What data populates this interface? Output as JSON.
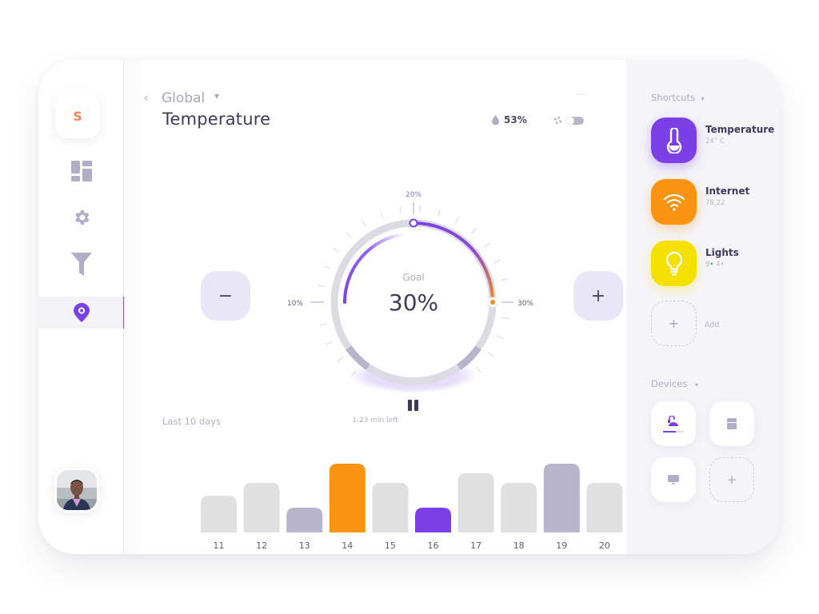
{
  "sidebar": {
    "logo_letter": "S",
    "nav": [
      {
        "name": "dashboard",
        "icon": "dashboard-icon",
        "active": false
      },
      {
        "name": "settings",
        "icon": "gear-icon",
        "active": false
      },
      {
        "name": "filter",
        "icon": "filter-icon",
        "active": false
      },
      {
        "name": "location",
        "icon": "location-pin-icon",
        "active": true
      }
    ],
    "avatar_alt": "User avatar"
  },
  "header": {
    "back_icon": "‹",
    "breadcrumb": "Global",
    "breadcrumb_caret": "▾",
    "title": "Temperature",
    "more_icon": "···",
    "humidity_value": "53%",
    "fan_toggle_on": false
  },
  "dial": {
    "goal_label": "Goal",
    "goal_value": "30%",
    "label_min": "10%",
    "label_top": "20%",
    "label_right": "30%",
    "current_percent": 20,
    "goal_percent": 30,
    "decrease_label": "−",
    "increase_label": "+",
    "time_left": "1:23 min left"
  },
  "history": {
    "title": "Last 10 days",
    "chart_data": {
      "type": "bar",
      "title": "Last 10 days",
      "categories": [
        "11",
        "12",
        "13",
        "14",
        "15",
        "16",
        "17",
        "18",
        "19",
        "20"
      ],
      "values": [
        46,
        62,
        31,
        86,
        62,
        31,
        74,
        62,
        86,
        62
      ],
      "highlight": {
        "14": "orange",
        "16": "purple",
        "13": "muted",
        "19": "muted"
      },
      "ylim": [
        0,
        100
      ],
      "grid": false
    },
    "colors": {
      "default": "#e0e0e0",
      "muted": "#b7b4cb",
      "orange": "#fa9410",
      "purple": "#7b3fe8"
    }
  },
  "right_panel": {
    "shortcuts_title": "Shortcuts",
    "shortcuts": [
      {
        "name": "Temperature",
        "sub": "24° C",
        "icon": "thermometer-icon",
        "color": "#7b3fe8"
      },
      {
        "name": "Internet",
        "sub": "78,22",
        "icon": "wifi-icon",
        "color": "#fa9410"
      },
      {
        "name": "Lights",
        "sub_on": "9",
        "sub_off": "4",
        "icon": "lightbulb-icon",
        "color": "#f5e000"
      }
    ],
    "add_label": "Add",
    "devices_title": "Devices",
    "devices": [
      {
        "icon": "vacuum-icon",
        "active": true
      },
      {
        "icon": "fridge-icon",
        "active": false
      },
      {
        "icon": "monitor-icon",
        "active": false
      },
      {
        "icon": "add-icon",
        "active": false
      }
    ]
  }
}
